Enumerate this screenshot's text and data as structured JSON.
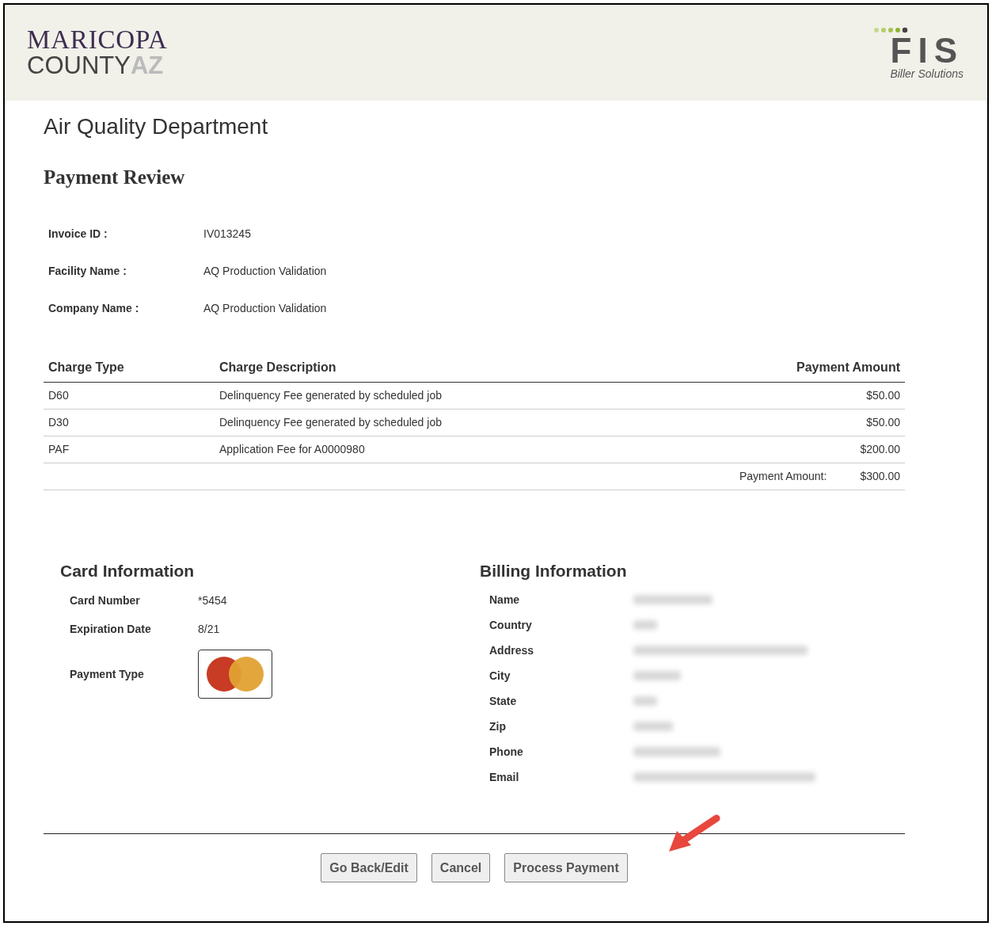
{
  "header": {
    "county_logo": {
      "line1": "MARICOPA",
      "line2": "COUNTY",
      "suffix": "AZ"
    },
    "vendor_logo": {
      "mark": "FIS",
      "tagline": "Biller Solutions"
    }
  },
  "department": "Air Quality Department",
  "title": "Payment Review",
  "summary": [
    {
      "label": "Invoice ID :",
      "value": "IV013245"
    },
    {
      "label": "Facility Name :",
      "value": "AQ Production Validation"
    },
    {
      "label": "Company Name :",
      "value": "AQ Production Validation"
    }
  ],
  "table": {
    "columns": [
      "Charge Type",
      "Charge Description",
      "Payment Amount"
    ],
    "rows": [
      [
        "D60",
        "Delinquency Fee generated by scheduled job",
        "$50.00"
      ],
      [
        "D30",
        "Delinquency Fee generated by scheduled job",
        "$50.00"
      ],
      [
        "PAF",
        "Application Fee for A0000980",
        "$200.00"
      ]
    ],
    "total": {
      "label": "Payment Amount:",
      "value": "$300.00"
    }
  },
  "card": {
    "title": "Card Information",
    "fields": [
      {
        "label": "Card Number",
        "value": "*5454"
      },
      {
        "label": "Expiration Date",
        "value": "8/21"
      }
    ],
    "payment_type_label": "Payment Type"
  },
  "billing": {
    "title": "Billing Information",
    "fields": [
      "Name",
      "Country",
      "Address",
      "City",
      "State",
      "Zip",
      "Phone",
      "Email"
    ]
  },
  "buttons": [
    "Go Back/Edit",
    "Cancel",
    "Process Payment"
  ]
}
